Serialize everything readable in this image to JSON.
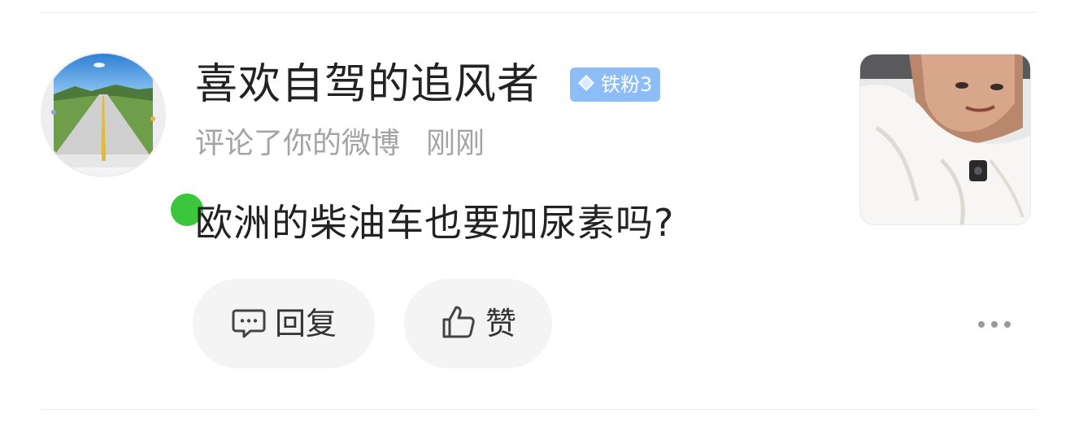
{
  "notification": {
    "username": "喜欢自驾的追风者",
    "badge": {
      "icon": "diamond-icon",
      "label": "铁粉3",
      "color": "#8cbdf6"
    },
    "action_text": "评论了你的微博",
    "time_text": "刚刚",
    "comment_text": "欧洲的柴油车也要加尿素吗?",
    "online_status_color": "#3bc63b"
  },
  "actions": {
    "reply": {
      "label": "回复",
      "icon": "comment-bubble-icon"
    },
    "like": {
      "label": "赞",
      "icon": "thumbs-up-icon"
    },
    "more": {
      "icon": "more-dots-icon"
    }
  },
  "colors": {
    "username": "#222222",
    "secondary_text": "#a4a4a4",
    "pill_background": "#f4f4f4"
  }
}
